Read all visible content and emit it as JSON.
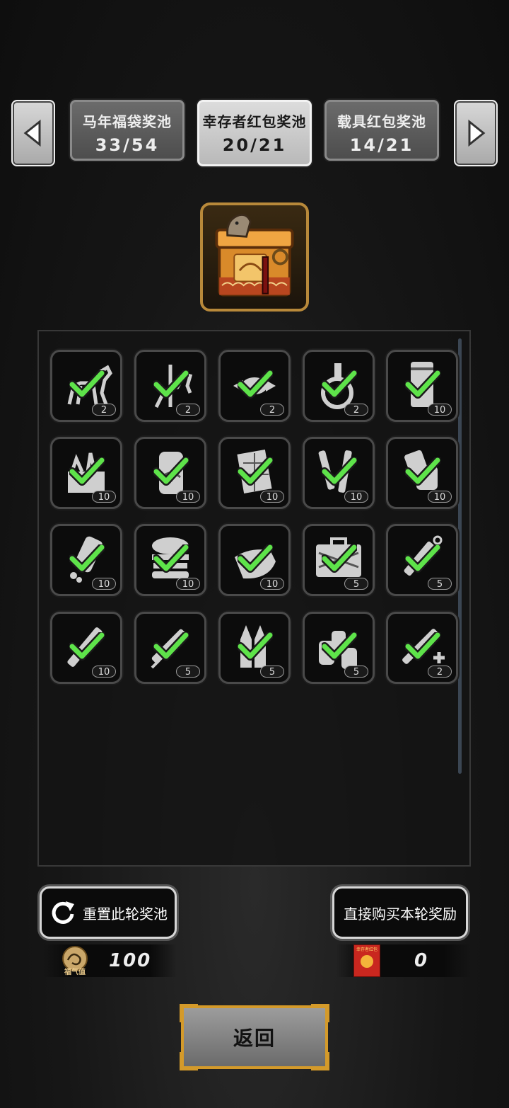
{
  "tabs": [
    {
      "name": "马年福袋奖池",
      "count": "33/54",
      "active": false
    },
    {
      "name": "幸存者红包奖池",
      "count": "20/21",
      "active": true
    },
    {
      "name": "载具红包奖池",
      "count": "14/21",
      "active": false
    }
  ],
  "items": [
    {
      "icon": "horse-statue-icon",
      "qty": "2",
      "collected": true
    },
    {
      "icon": "carousel-horse-icon",
      "qty": "2",
      "collected": true
    },
    {
      "icon": "candy-icon",
      "qty": "2",
      "collected": true
    },
    {
      "icon": "grenade-flask-icon",
      "qty": "2",
      "collected": true
    },
    {
      "icon": "coffee-can-icon",
      "qty": "10",
      "collected": true
    },
    {
      "icon": "food-basket-icon",
      "qty": "10",
      "collected": true
    },
    {
      "icon": "soda-can-icon",
      "qty": "10",
      "collected": true
    },
    {
      "icon": "chocolate-bar-icon",
      "qty": "10",
      "collected": true
    },
    {
      "icon": "battery-pack-icon",
      "qty": "10",
      "collected": true
    },
    {
      "icon": "bandage-roll-icon",
      "qty": "10",
      "collected": true
    },
    {
      "icon": "spilled-bottle-icon",
      "qty": "10",
      "collected": true
    },
    {
      "icon": "burger-icon",
      "qty": "10",
      "collected": true
    },
    {
      "icon": "cloth-rag-icon",
      "qty": "10",
      "collected": true
    },
    {
      "icon": "medkit-icon",
      "qty": "5",
      "collected": true
    },
    {
      "icon": "adrenaline-pen-icon",
      "qty": "5",
      "collected": true
    },
    {
      "icon": "stim-injector-icon",
      "qty": "10",
      "collected": true
    },
    {
      "icon": "syringe-icon",
      "qty": "5",
      "collected": true
    },
    {
      "icon": "bullets-icon",
      "qty": "5",
      "collected": true
    },
    {
      "icon": "spray-cans-icon",
      "qty": "5",
      "collected": true
    },
    {
      "icon": "medical-syringe-icon",
      "qty": "2",
      "collected": true
    }
  ],
  "actions": {
    "reset_label": "重置此轮奖池",
    "buy_label": "直接购买本轮奖励",
    "back_label": "返回"
  },
  "currency": {
    "fortune_label": "福气值",
    "fortune_value": "100",
    "redpacket_label": "幸存者红包",
    "redpacket_value": "0"
  },
  "colors": {
    "check_green": "#5ee34a",
    "gold_frame": "#d49a2a"
  }
}
